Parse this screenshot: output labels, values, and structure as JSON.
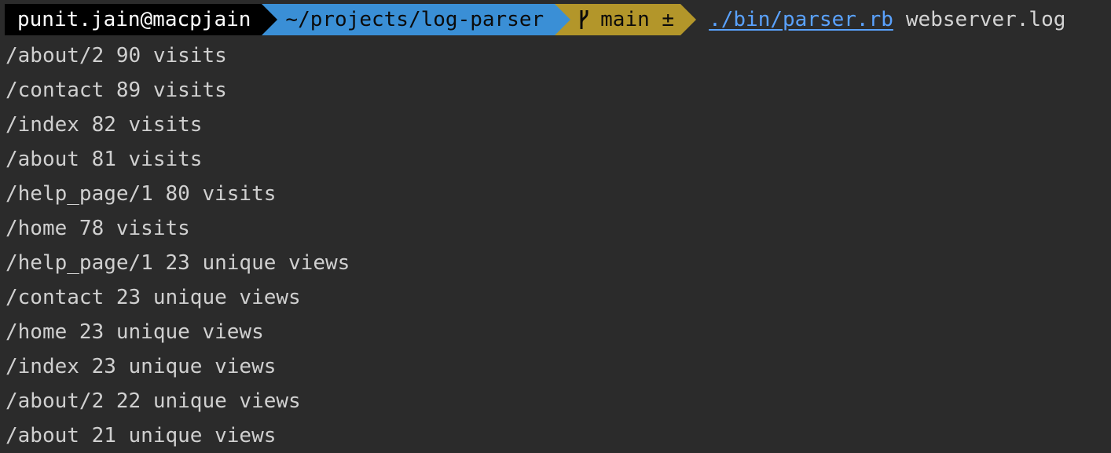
{
  "prompt": {
    "user": "punit.jain@macpjain",
    "directory": "~/projects/log-parser",
    "branch": "main ±",
    "command": "./bin/parser.rb",
    "argument": "webserver.log"
  },
  "branch_icon": "git-branch-icon",
  "colors": {
    "background": "#2b2b2b",
    "user_segment": "#000000",
    "directory_segment": "#3a8fd6",
    "git_segment": "#b3962a",
    "command_link": "#5aa2ff",
    "text": "#d0d0d0"
  },
  "output": [
    "/about/2 90 visits",
    "/contact 89 visits",
    "/index 82 visits",
    "/about 81 visits",
    "/help_page/1 80 visits",
    "/home 78 visits",
    "/help_page/1 23 unique views",
    "/contact 23 unique views",
    "/home 23 unique views",
    "/index 23 unique views",
    "/about/2 22 unique views",
    "/about 21 unique views"
  ]
}
